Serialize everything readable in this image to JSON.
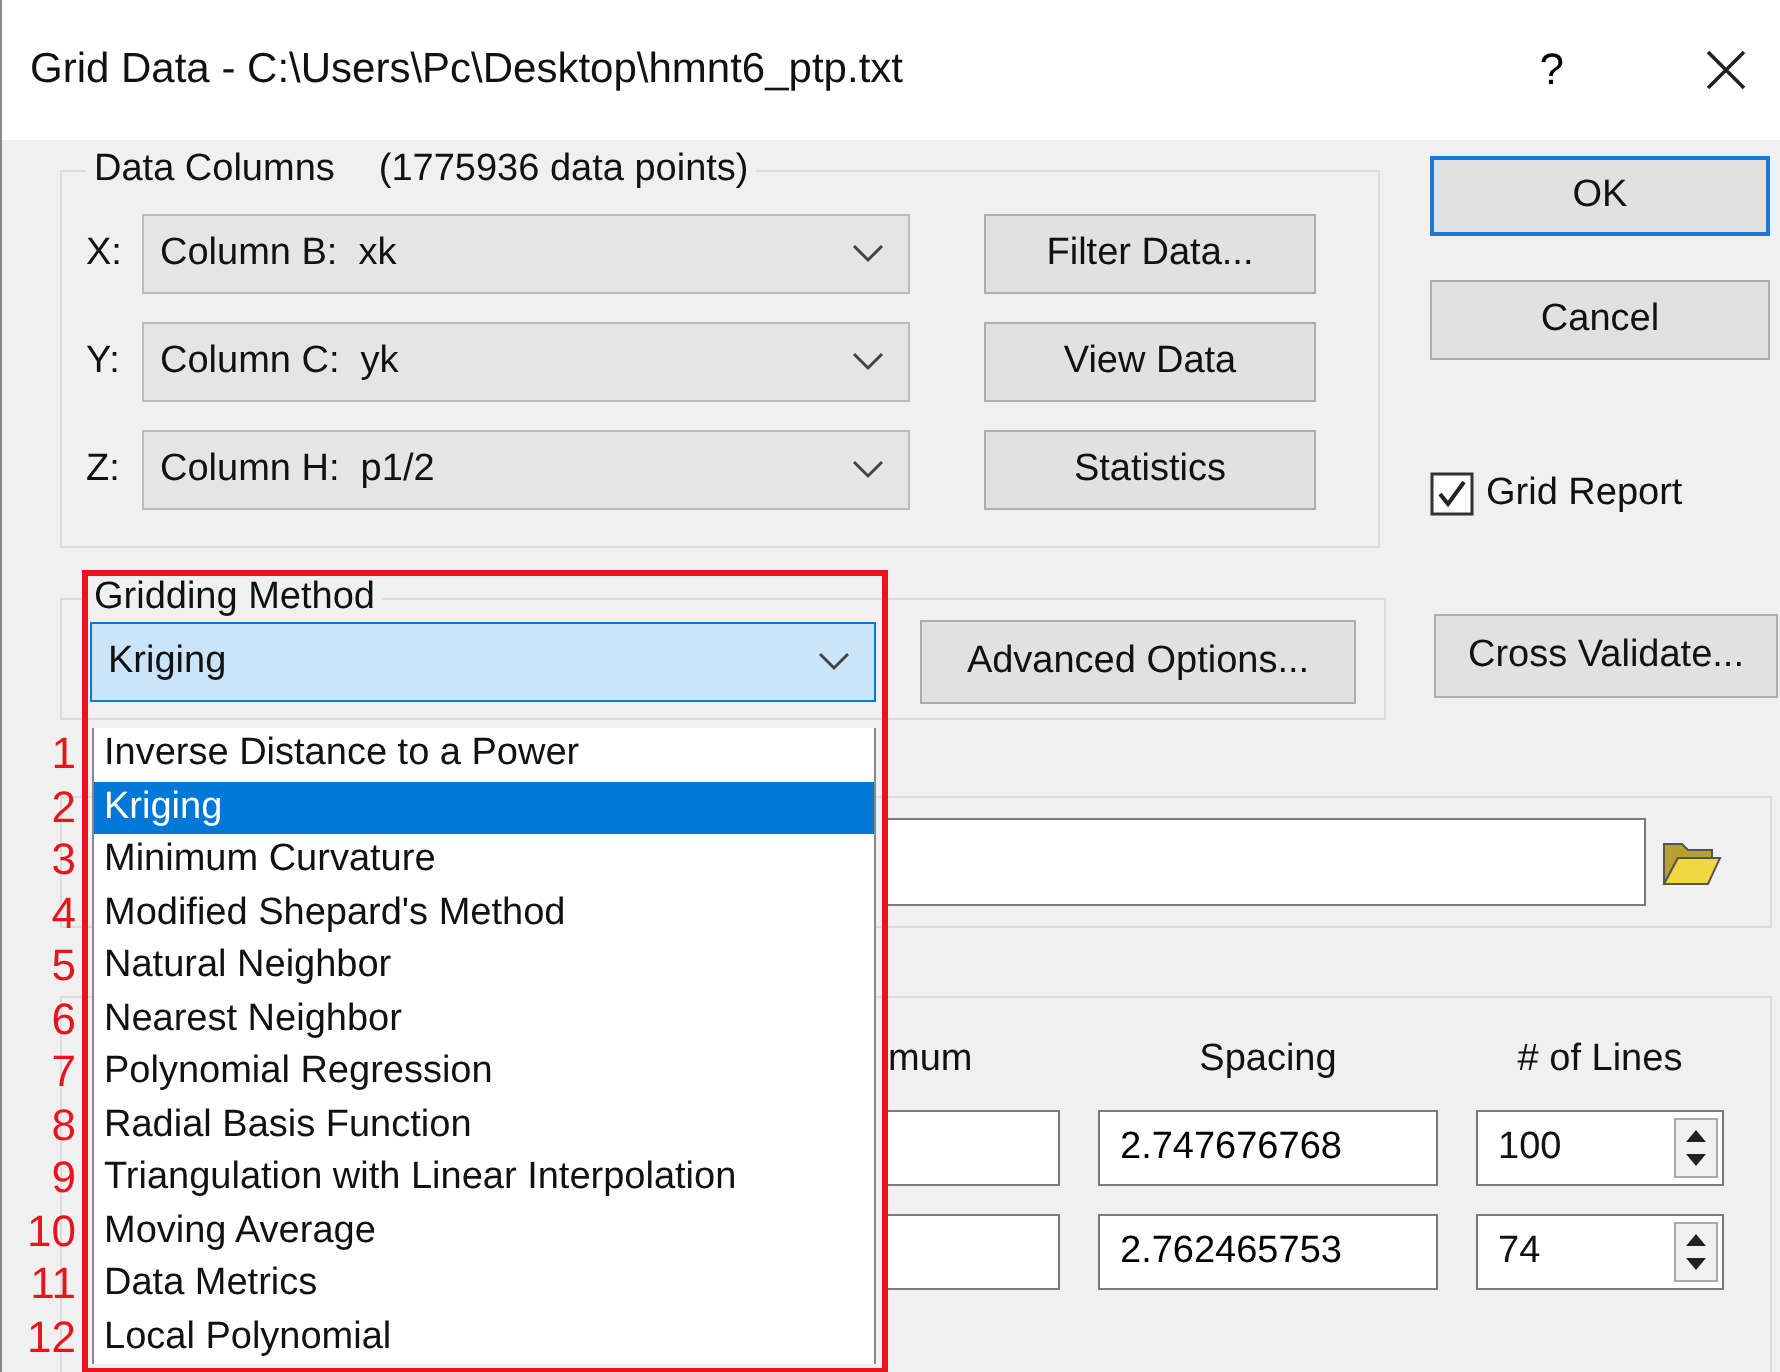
{
  "window": {
    "title": "Grid Data - C:\\Users\\Pc\\Desktop\\hmnt6_ptp.txt",
    "help": "?"
  },
  "data_columns": {
    "legend": "Data Columns",
    "count": "(1775936 data points)",
    "rows": [
      {
        "axis": "X:",
        "value": "Column B:  xk",
        "button": "Filter Data..."
      },
      {
        "axis": "Y:",
        "value": "Column C:  yk",
        "button": "View Data"
      },
      {
        "axis": "Z:",
        "value": "Column H:  p1/2",
        "button": "Statistics"
      }
    ]
  },
  "buttons": [
    {
      "label": "OK",
      "default": true
    },
    {
      "label": "Cancel",
      "default": false
    }
  ],
  "grid_report": {
    "label": "Grid Report",
    "checked": true
  },
  "gridding_method": {
    "legend": "Gridding Method",
    "value": "Kriging",
    "expanded": true,
    "advanced_button": "Advanced Options...",
    "options": [
      {
        "marker": "1",
        "label": "Inverse Distance to a Power",
        "selected": false
      },
      {
        "marker": "2",
        "label": "Kriging",
        "selected": true
      },
      {
        "marker": "3",
        "label": "Minimum Curvature",
        "selected": false
      },
      {
        "marker": "4",
        "label": "Modified Shepard's Method",
        "selected": false
      },
      {
        "marker": "5",
        "label": "Natural Neighbor",
        "selected": false
      },
      {
        "marker": "6",
        "label": "Nearest Neighbor",
        "selected": false
      },
      {
        "marker": "7",
        "label": "Polynomial Regression",
        "selected": false
      },
      {
        "marker": "8",
        "label": "Radial Basis Function",
        "selected": false
      },
      {
        "marker": "9",
        "label": "Triangulation with Linear Interpolation",
        "selected": false
      },
      {
        "marker": "10",
        "label": "Moving Average",
        "selected": false
      },
      {
        "marker": "11",
        "label": "Data Metrics",
        "selected": false
      },
      {
        "marker": "12",
        "label": "Local Polynomial",
        "selected": false
      }
    ]
  },
  "cross_validate_button": "Cross Validate...",
  "grid_geometry": {
    "headers": [
      "mum",
      "Spacing",
      "# of Lines"
    ],
    "rows": [
      {
        "spacing": "2.747676768",
        "lines": "100"
      },
      {
        "spacing": "2.762465753",
        "lines": "74"
      }
    ]
  }
}
